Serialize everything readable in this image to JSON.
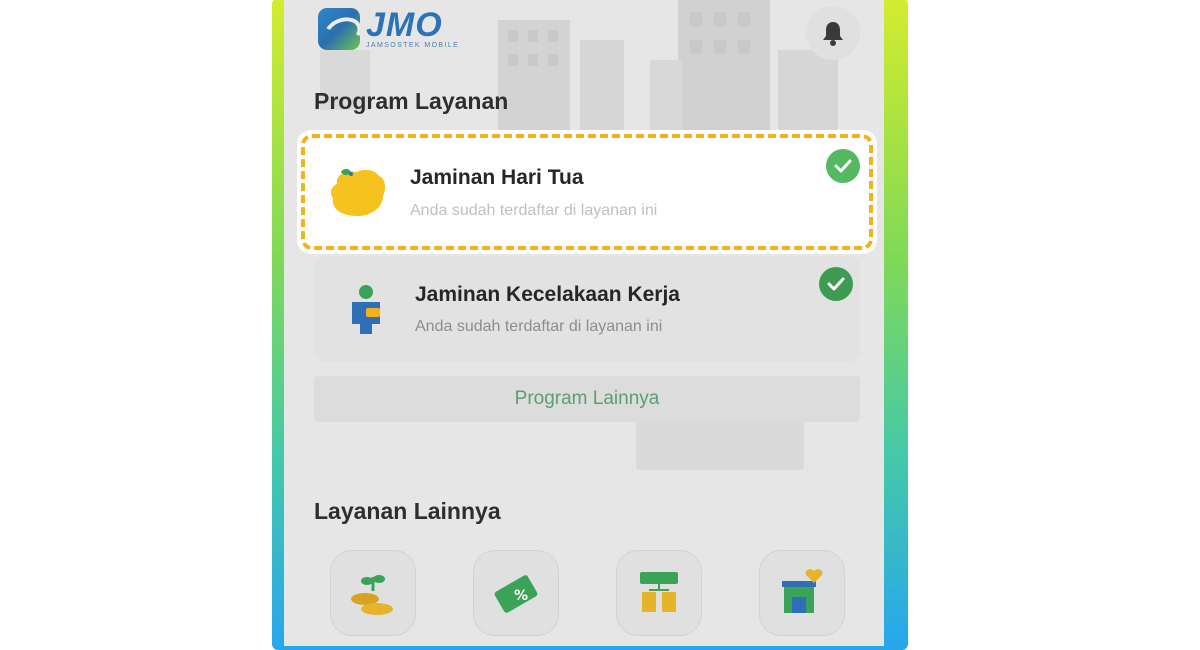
{
  "app": {
    "logo_text": "JMO",
    "logo_subtitle": "JAMSOSTEK MOBILE"
  },
  "program_layanan": {
    "title": "Program Layanan",
    "items": [
      {
        "title": "Jaminan Hari Tua",
        "subtitle": "Anda sudah terdaftar di layanan ini",
        "icon": "piggy-bank-icon",
        "status": "registered-check-icon"
      },
      {
        "title": "Jaminan Kecelakaan Kerja",
        "subtitle": "Anda sudah terdaftar di layanan ini",
        "icon": "worker-icon",
        "status": "registered-check-icon"
      }
    ],
    "more_button": "Program Lainnya"
  },
  "layanan_lainnya": {
    "title": "Layanan Lainnya",
    "items": [
      {
        "icon": "plant-coins-icon"
      },
      {
        "icon": "discount-voucher-icon"
      },
      {
        "icon": "office-board-icon"
      },
      {
        "icon": "shop-heart-icon"
      }
    ]
  },
  "colors": {
    "highlight_border": "#f2b21c",
    "check_green": "#3f9b52",
    "accent_green_text": "#5d9e6d",
    "logo_blue": "#2b73b5"
  }
}
